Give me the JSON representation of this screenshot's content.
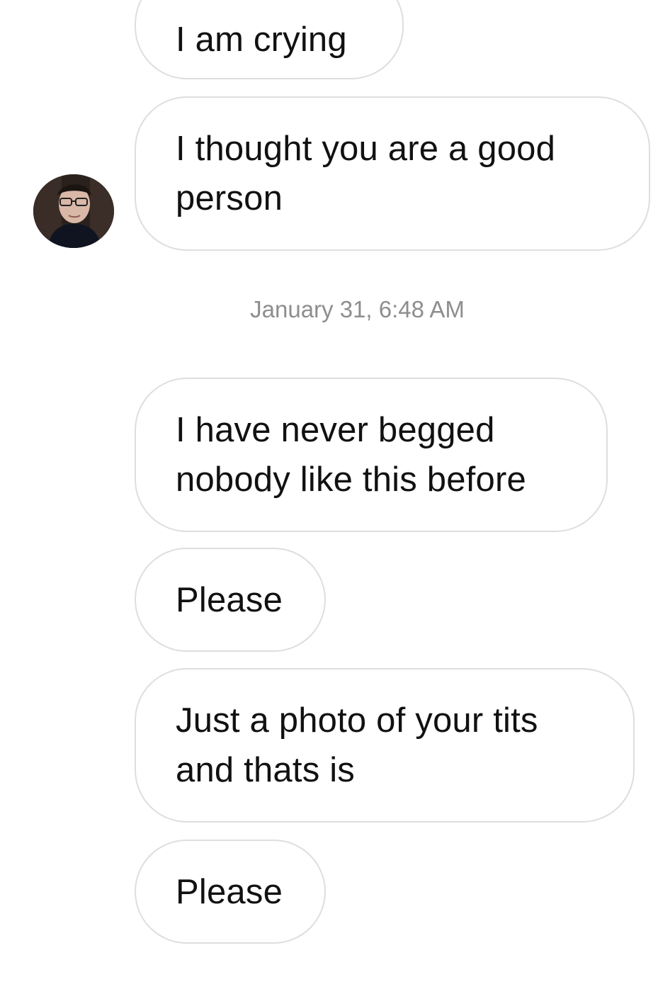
{
  "conversation": {
    "messages": [
      {
        "text": "I am crying"
      },
      {
        "text": "I thought you are a good\nperson"
      },
      {
        "text": "I have never begged\nnobody like this before"
      },
      {
        "text": "Please"
      },
      {
        "text": "Just a photo of your tits\nand thats is"
      },
      {
        "text": "Please"
      }
    ],
    "timestamp": "January 31, 6:48 AM"
  },
  "sender": {
    "avatar_icon": "profile-photo-icon"
  }
}
